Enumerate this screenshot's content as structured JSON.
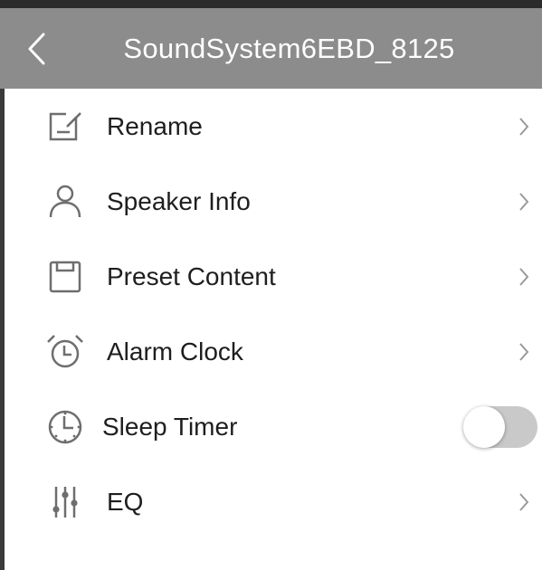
{
  "header": {
    "title": "SoundSystem6EBD_8125",
    "background": "#8c8c8c",
    "back_icon": "chevron-left-icon"
  },
  "menu": {
    "items": [
      {
        "label": "Rename",
        "icon": "edit-icon",
        "control": "chevron-right-icon"
      },
      {
        "label": "Speaker Info",
        "icon": "person-icon",
        "control": "chevron-right-icon"
      },
      {
        "label": "Preset Content",
        "icon": "floppy-disk-icon",
        "control": "chevron-right-icon"
      },
      {
        "label": "Alarm Clock",
        "icon": "alarm-clock-icon",
        "control": "chevron-right-icon"
      },
      {
        "label": "Sleep Timer",
        "icon": "timer-icon",
        "control": "toggle",
        "toggle_on": false
      },
      {
        "label": "EQ",
        "icon": "equalizer-icon",
        "control": "chevron-right-icon"
      }
    ]
  },
  "colors": {
    "text": "#1e1e1e",
    "icon": "#6e6e6e",
    "chevron": "#9a9a9a",
    "toggle_track": "#c9c9c9"
  }
}
